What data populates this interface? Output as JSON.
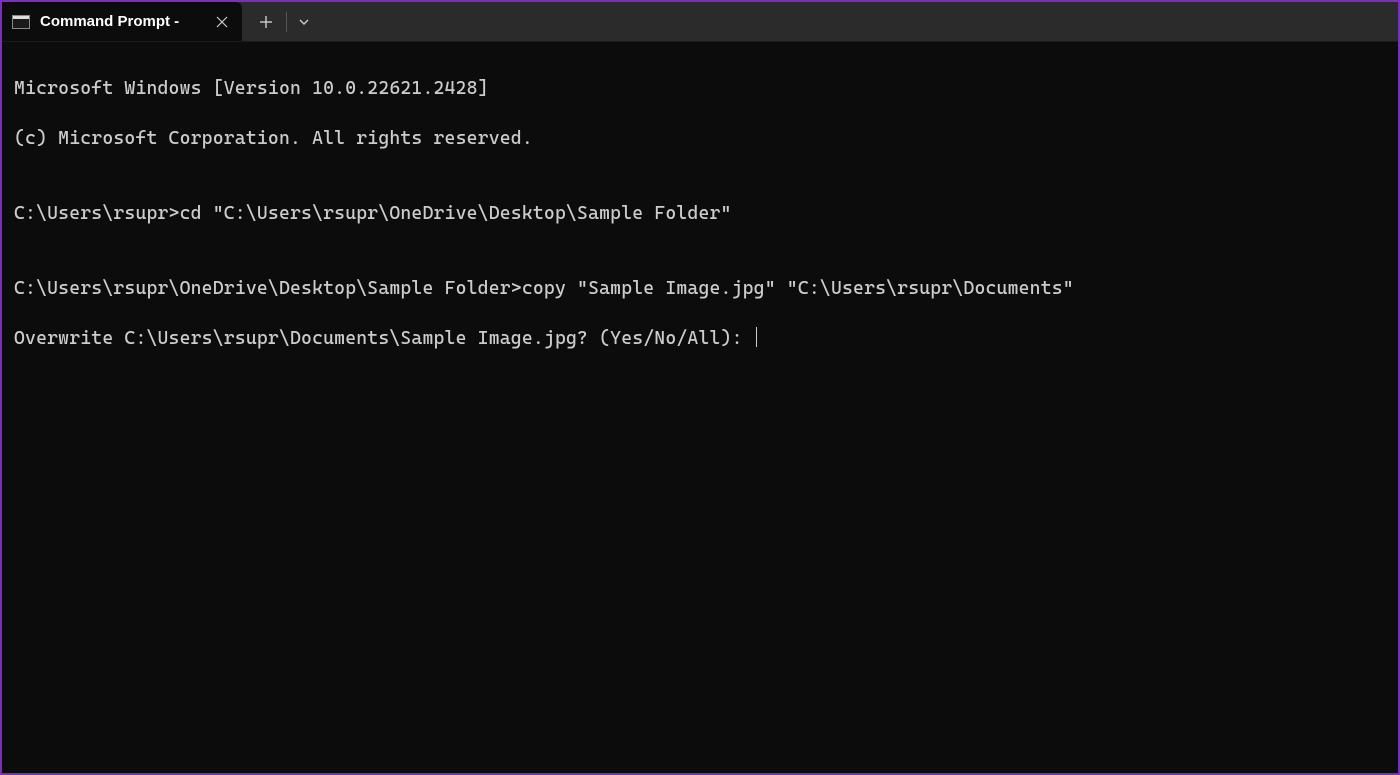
{
  "titlebar": {
    "tab": {
      "title": "Command Prompt -"
    }
  },
  "terminal": {
    "line1": "Microsoft Windows [Version 10.0.22621.2428]",
    "line2": "(c) Microsoft Corporation. All rights reserved.",
    "blank1": "",
    "line3": "C:\\Users\\rsupr>cd \"C:\\Users\\rsupr\\OneDrive\\Desktop\\Sample Folder\"",
    "blank2": "",
    "line4": "C:\\Users\\rsupr\\OneDrive\\Desktop\\Sample Folder>copy \"Sample Image.jpg\" \"C:\\Users\\rsupr\\Documents\"",
    "line5": "Overwrite C:\\Users\\rsupr\\Documents\\Sample Image.jpg? (Yes/No/All): "
  }
}
